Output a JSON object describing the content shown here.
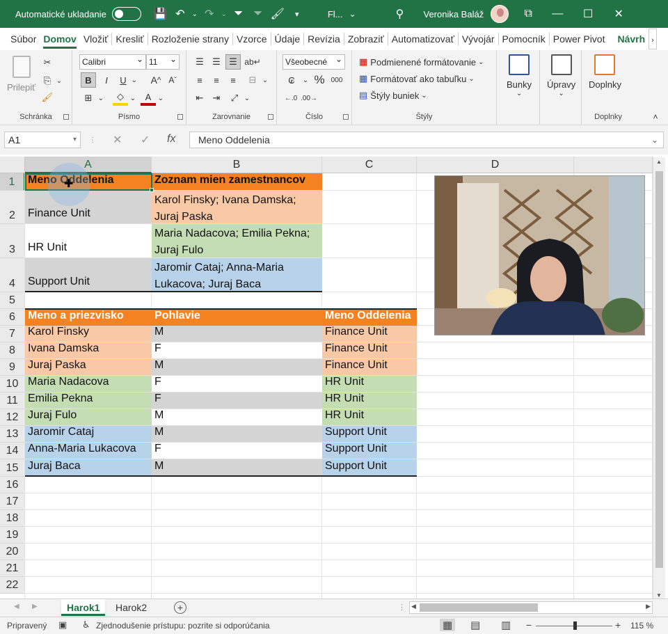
{
  "titlebar": {
    "autosave_label": "Automatické ukladanie",
    "filename": "Fl...",
    "username": "Veronika Baláž"
  },
  "tabs": [
    "Súbor",
    "Domov",
    "Vložiť",
    "Kresliť",
    "Rozloženie strany",
    "Vzorce",
    "Údaje",
    "Revízia",
    "Zobraziť",
    "Automatizovať",
    "Vývojár",
    "Pomocník",
    "Power Pivot",
    "Návrh"
  ],
  "ribbon": {
    "clipboard": {
      "paste": "Prilepiť",
      "label": "Schránka"
    },
    "font": {
      "name": "Calibri",
      "size": "11",
      "label": "Písmo",
      "bold": "B",
      "italic": "I",
      "underline": "U"
    },
    "alignment": {
      "label": "Zarovnanie"
    },
    "number": {
      "format": "Všeobecné",
      "label": "Číslo",
      "percent": "%",
      "thousands": "000"
    },
    "styles": {
      "cond": "Podmienené formátovanie",
      "table": "Formátovať ako tabuľku",
      "cellstyles": "Štýly buniek",
      "label": "Štýly"
    },
    "cells": {
      "label": "Bunky"
    },
    "editing": {
      "label": "Úpravy"
    },
    "addins": {
      "button": "Doplnky",
      "label": "Doplnky"
    }
  },
  "formulabar": {
    "namebox": "A1",
    "fx": "fx",
    "content": "Meno Oddelenia"
  },
  "columns": [
    "A",
    "B",
    "C",
    "D"
  ],
  "rows": [
    "1",
    "2",
    "3",
    "4",
    "5",
    "6",
    "7",
    "8",
    "9",
    "10",
    "11",
    "12",
    "13",
    "14",
    "15",
    "16",
    "17",
    "18",
    "19",
    "20",
    "21",
    "22"
  ],
  "table1": {
    "headers": [
      "Meno Oddelenia",
      "Zoznam mien zamestnancov"
    ],
    "rows": [
      {
        "dept": "Finance Unit",
        "names": "Karol Finsky; Ivana Damska; Juraj Paska"
      },
      {
        "dept": "HR Unit",
        "names": "Maria Nadacova; Emilia Pekna; Juraj Fulo"
      },
      {
        "dept": "Support Unit",
        "names": "Jaromir Cataj; Anna-Maria Lukacova; Juraj Baca"
      }
    ]
  },
  "table2": {
    "headers": [
      "Meno a priezvisko",
      "Pohlavie",
      "Meno Oddelenia"
    ],
    "rows": [
      [
        "Karol Finsky",
        "M",
        "Finance Unit"
      ],
      [
        "Ivana Damska",
        "F",
        "Finance Unit"
      ],
      [
        "Juraj Paska",
        "M",
        "Finance Unit"
      ],
      [
        "Maria Nadacova",
        "F",
        "HR Unit"
      ],
      [
        "Emilia Pekna",
        "F",
        "HR Unit"
      ],
      [
        "Juraj Fulo",
        "M",
        "HR Unit"
      ],
      [
        "Jaromir Cataj",
        "M",
        "Support Unit"
      ],
      [
        "Anna-Maria Lukacova",
        "F",
        "Support Unit"
      ],
      [
        "Juraj Baca",
        "M",
        "Support Unit"
      ]
    ]
  },
  "sheets": [
    "Harok1",
    "Harok2"
  ],
  "statusbar": {
    "ready": "Pripravený",
    "accessibility": "Zjednodušenie prístupu: pozrite si odporúčania",
    "zoom": "115 %"
  },
  "colors": {
    "excel_green": "#217346",
    "orange": "#F58220",
    "peach": "#F9C9A6",
    "green": "#C5DDB3",
    "blue": "#B8D2EA",
    "gray": "#D4D4D4"
  }
}
